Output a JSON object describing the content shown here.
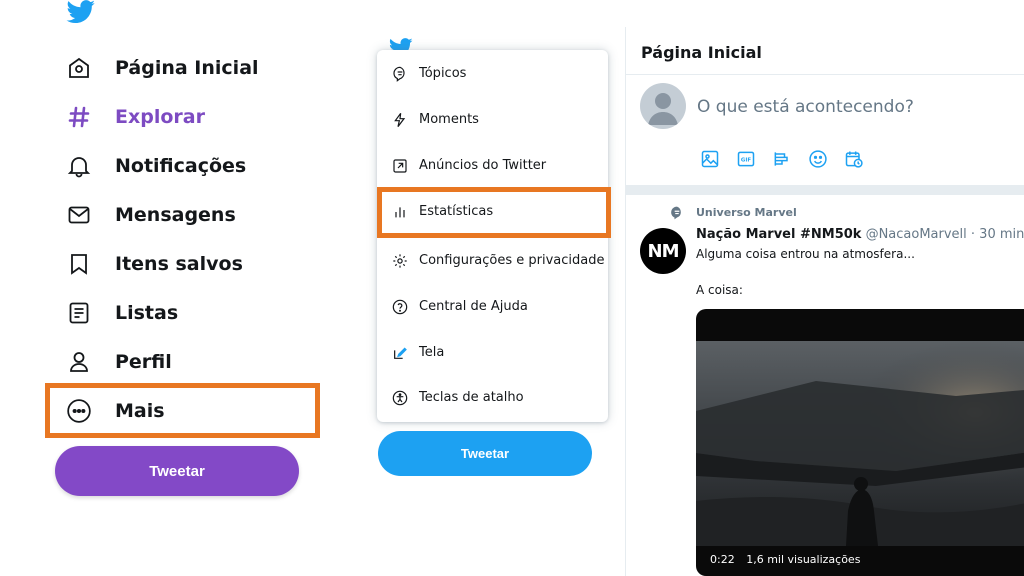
{
  "nav": {
    "items": [
      {
        "label": "Página Inicial",
        "icon": "home-icon",
        "active": false
      },
      {
        "label": "Explorar",
        "icon": "hashtag-icon",
        "active": true
      },
      {
        "label": "Notificações",
        "icon": "bell-icon",
        "active": false
      },
      {
        "label": "Mensagens",
        "icon": "envelope-icon",
        "active": false
      },
      {
        "label": "Itens salvos",
        "icon": "bookmark-icon",
        "active": false
      },
      {
        "label": "Listas",
        "icon": "list-icon",
        "active": false
      },
      {
        "label": "Perfil",
        "icon": "person-icon",
        "active": false
      },
      {
        "label": "Mais",
        "icon": "more-circle-icon",
        "active": false
      }
    ],
    "tweet_button": "Tweetar"
  },
  "menu": {
    "items": [
      {
        "label": "Tópicos",
        "icon": "topics-icon"
      },
      {
        "label": "Moments",
        "icon": "lightning-icon"
      },
      {
        "label": "Anúncios do Twitter",
        "icon": "external-arrow-icon"
      },
      {
        "label": "Estatísticas",
        "icon": "bar-chart-icon"
      },
      {
        "label": "Configurações e privacidade",
        "icon": "gear-icon"
      },
      {
        "label": "Central de Ajuda",
        "icon": "help-icon"
      },
      {
        "label": "Tela",
        "icon": "pen-icon"
      },
      {
        "label": "Teclas de atalho",
        "icon": "accessibility-icon"
      }
    ],
    "tweet_button": "Tweetar"
  },
  "timeline": {
    "title": "Página Inicial",
    "compose_placeholder": "O que está acontecendo?",
    "tweet": {
      "context": "Universo Marvel",
      "avatar_text": "NM",
      "name": "Nação Marvel #NM50k",
      "handle": "@NacaoMarvell · 30 min",
      "text1": "Alguma coisa entrou na atmosfera...",
      "text2": "A coisa:",
      "video_time": "0:22",
      "video_views": "1,6 mil visualizações"
    }
  },
  "colors": {
    "accent_purple": "#7d4bc2",
    "tweet_left": "#8349c7",
    "twitter_blue": "#1da1f2",
    "highlight_orange": "#e87722"
  }
}
